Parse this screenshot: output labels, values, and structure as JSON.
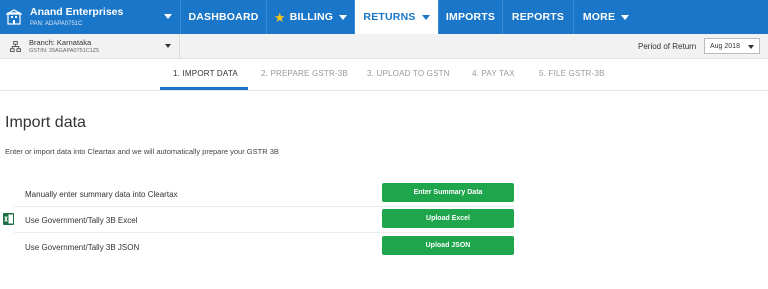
{
  "org": {
    "name": "Anand Enterprises",
    "pan": "PAN: ADAPA0751C"
  },
  "nav": {
    "items": [
      {
        "label": "DASHBOARD"
      },
      {
        "label": "BILLING"
      },
      {
        "label": "RETURNS"
      },
      {
        "label": "IMPORTS"
      },
      {
        "label": "REPORTS"
      },
      {
        "label": "MORE"
      }
    ]
  },
  "branch": {
    "name": "Branch: Karnataka",
    "gstin": "GSTIN: 29AGAPA0751C1Z5"
  },
  "period": {
    "label": "Period of Return",
    "value": "Aug 2018"
  },
  "steps": [
    {
      "label": "1. IMPORT DATA"
    },
    {
      "label": "2. PREPARE GSTR-3B"
    },
    {
      "label": "3. UPLOAD TO GSTN"
    },
    {
      "label": "4. PAY TAX"
    },
    {
      "label": "5. FILE GSTR-3B"
    }
  ],
  "main": {
    "title": "Import data",
    "subtitle": "Enter or import data into Cleartax and we will automatically prepare your GSTR 3B",
    "options": [
      {
        "label": "Manually enter summary data into Cleartax",
        "button": "Enter Summary Data"
      },
      {
        "label": "Use Government/Tally 3B Excel",
        "button": "Upload Excel"
      },
      {
        "label": "Use Government/Tally 3B JSON",
        "button": "Upload JSON"
      }
    ]
  },
  "colors": {
    "brand": "#1976c8",
    "success": "#1fa64d",
    "star": "#f5c518"
  }
}
